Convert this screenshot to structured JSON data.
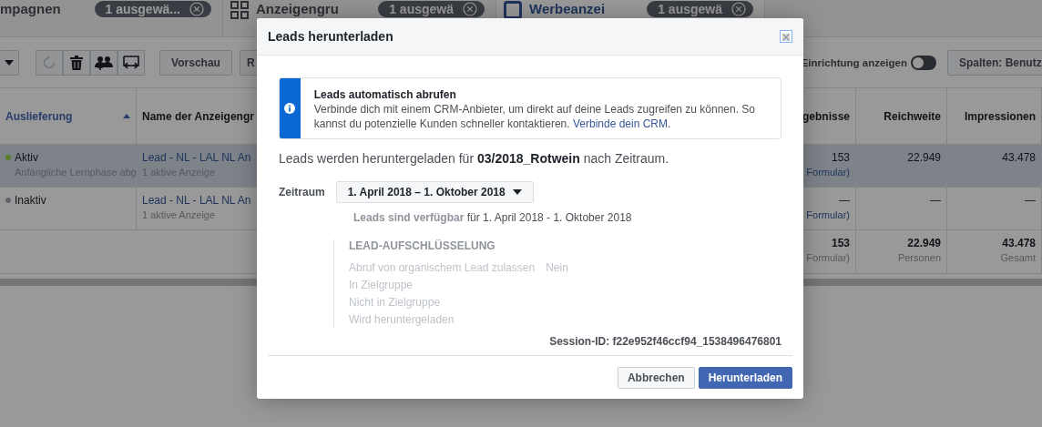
{
  "tabs": [
    {
      "label": "mpagnen",
      "badge": "1 ausgewä...",
      "selected": false
    },
    {
      "label": "Anzeigengru",
      "badge": "1 ausgewä",
      "selected": false
    },
    {
      "label": "Werbeanzei",
      "badge": "1 ausgewä",
      "selected": true
    }
  ],
  "toolbar": {
    "buttons": [
      "Vorschau",
      "R"
    ],
    "setup_toggle": {
      "label": "Einrichtung anzeigen",
      "on": false
    },
    "columns_button": "Spalten: Benutz"
  },
  "table": {
    "columns": [
      {
        "label": "Auslieferung",
        "sorted": true
      },
      {
        "label": "Name der Anzeigengr",
        "sorted": false
      },
      {
        "label": "gebnisse",
        "sorted": false
      },
      {
        "label": "Reichweite",
        "sorted": false
      },
      {
        "label": "Impressionen",
        "sorted": false
      }
    ],
    "rows": [
      {
        "status": "Aktiv",
        "color": "#5b7f2f",
        "status_note": "Anfängliche Lernphase abg",
        "name": "Lead - NL - LAL NL An",
        "name_note": "1 aktive Anzeige",
        "results": "153",
        "results_note": "Formular)",
        "reach": "22.949",
        "impressions": "43.478",
        "selected": true
      },
      {
        "status": "Inaktiv",
        "color": "#5f6268",
        "name": "Lead - NL - LAL NL An",
        "name_note": "1 aktive Anzeige",
        "results": "—",
        "results_note": "Formular)",
        "reach": "—",
        "impressions": "—",
        "selected": false
      }
    ],
    "totals": {
      "results": "153",
      "results_note": "Formular)",
      "reach": "22.949",
      "reach_note": "Personen",
      "impressions": "43.478",
      "impressions_note": "Gesamt"
    }
  },
  "dialog": {
    "title": "Leads herunterladen",
    "info": {
      "title": "Leads automatisch abrufen",
      "text": "Verbinde dich mit einem CRM-Anbieter, um direkt auf deine Leads zugreifen zu können. So kannst du potenzielle Kunden schneller kontaktieren.",
      "link": "Verbinde dein CRM."
    },
    "intro": "Leads werden heruntergeladen für **03/2018_Rotwein** nach Zeitraum.",
    "range_label": "Zeitraum",
    "range_value": "1. April 2018 – 1. Oktober 2018",
    "availability": "**Leads sind verfügbar** für 1. April 2018 - 1. Oktober 2018",
    "breakdown": {
      "title": "LEAD-AUFSCHLÜSSELUNG",
      "rows": [
        {
          "label": "Abruf von organischem Lead zulassen",
          "value": "Nein"
        },
        {
          "label": "In Zielgruppe"
        },
        {
          "label": "Nicht in Zielgruppe"
        },
        {
          "label": "Wird heruntergeladen"
        }
      ]
    },
    "session": "Session-ID: f22e952f46ccf94_1538496476801",
    "buttons": [
      {
        "label": "Abbrechen",
        "primary": false
      },
      {
        "label": "Herunterladen",
        "primary": true
      }
    ]
  }
}
